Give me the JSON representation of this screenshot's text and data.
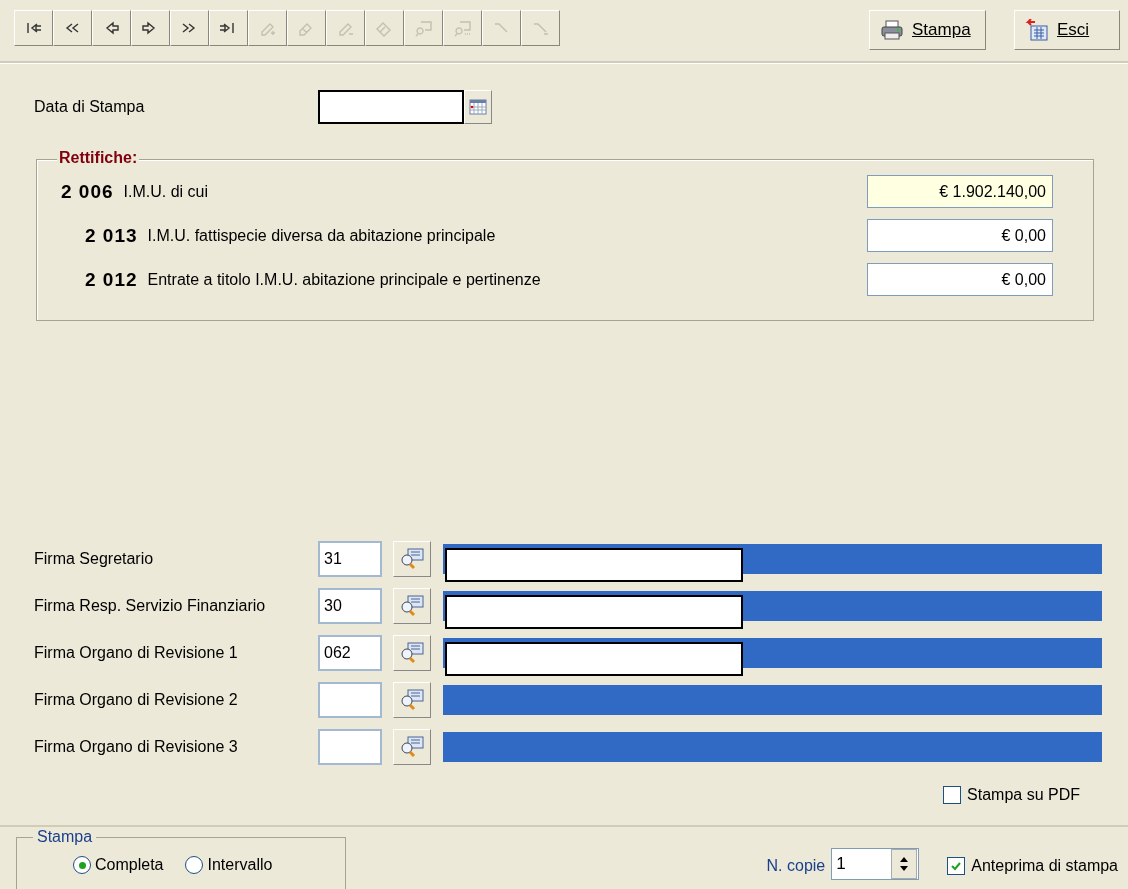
{
  "toolbar": [
    {
      "kind": "first",
      "disabled": false
    },
    {
      "kind": "prev-page",
      "disabled": false
    },
    {
      "kind": "prev",
      "disabled": false
    },
    {
      "kind": "next",
      "disabled": false
    },
    {
      "kind": "next-page",
      "disabled": false
    },
    {
      "kind": "last",
      "disabled": false
    },
    {
      "kind": "add",
      "disabled": true
    },
    {
      "kind": "edit",
      "disabled": true
    },
    {
      "kind": "remove",
      "disabled": true
    },
    {
      "kind": "erase",
      "disabled": true
    },
    {
      "kind": "find",
      "disabled": true
    },
    {
      "kind": "find-more",
      "disabled": true
    },
    {
      "kind": "filter",
      "disabled": true
    },
    {
      "kind": "filter-clear",
      "disabled": true
    }
  ],
  "actions": [
    {
      "kind": "print",
      "label": "Stampa"
    },
    {
      "kind": "exit",
      "label": "Esci"
    }
  ],
  "print_date": {
    "label": "Data di Stampa"
  },
  "adjustments": {
    "title": "Rettifiche:",
    "rows": [
      {
        "code": "2 006",
        "label": "I.M.U. di cui",
        "value": "€ 1.902.140,00",
        "readonly": true,
        "children": [
          {
            "code": "2 013",
            "label": "I.M.U. fattispecie diversa da abitazione principale",
            "value": "€ 0,00",
            "readonly": false
          },
          {
            "code": "2 012",
            "label": "Entrate a titolo I.M.U. abitazione principale e pertinenze",
            "value": "€ 0,00",
            "readonly": false
          }
        ]
      }
    ]
  },
  "signatures": [
    {
      "label": "Firma Segretario",
      "code": "31",
      "redacted": true
    },
    {
      "label": "Firma Resp. Servizio Finanziario",
      "code": "30",
      "redacted": true
    },
    {
      "label": "Firma Organo di Revisione 1",
      "code": "062",
      "redacted": true
    },
    {
      "label": "Firma Organo di Revisione 2",
      "redacted": false
    },
    {
      "label": "Firma Organo di Revisione 3",
      "redacted": false
    }
  ],
  "pdf": {
    "label": "Stampa su PDF",
    "checked": false
  },
  "print_range": {
    "title": "Stampa",
    "options": [
      {
        "label": "Completa",
        "selected": true
      },
      {
        "label": "Intervallo",
        "selected": false
      }
    ]
  },
  "copies": {
    "label": "N. copie",
    "value": "1"
  },
  "preview": {
    "label": "Anteprima di stampa",
    "checked": true
  }
}
